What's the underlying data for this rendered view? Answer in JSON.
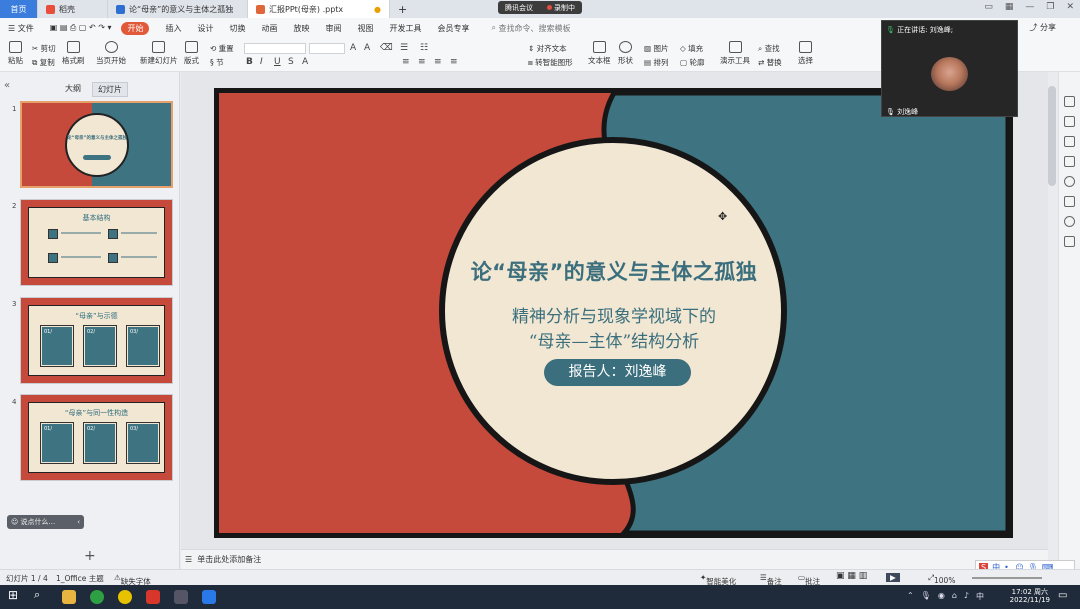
{
  "tabs": [
    {
      "label": "首页"
    },
    {
      "label": "稻壳"
    },
    {
      "label": "论“母亲”的意义与主体之孤独"
    },
    {
      "label": "汇报PPt(母亲) .pptx"
    }
  ],
  "meeting": {
    "app_label": "腾讯会议",
    "recording_label": "录制中"
  },
  "menu": {
    "file": "文件",
    "items": [
      "开始",
      "插入",
      "设计",
      "切换",
      "动画",
      "放映",
      "审阅",
      "视图",
      "开发工具",
      "会员专享"
    ],
    "active": "开始",
    "search_placeholder": "查找命令、搜索模板",
    "share": "分享"
  },
  "ribbon": {
    "paste": "粘贴",
    "cut": "剪切",
    "copy": "复制",
    "format_painter": "格式刷",
    "from_current": "当页开始",
    "new_slide": "新建幻灯片",
    "layout": "版式",
    "section": "节",
    "reset": "重置",
    "align_text": "对齐文本",
    "convert_smartart": "转智能图形",
    "textbox": "文本框",
    "shape": "形状",
    "picture": "图片",
    "fill": "填充",
    "arrange": "排列",
    "outline": "轮廓",
    "presentation_tools": "演示工具",
    "find": "查找",
    "replace": "替换",
    "select": "选择"
  },
  "leftpanel": {
    "tab_outline": "大纲",
    "tab_slides": "幻灯片",
    "slides": [
      {
        "num": "1",
        "title": "论“母亲”的意义与主体之孤独"
      },
      {
        "num": "2",
        "title": "基本结构"
      },
      {
        "num": "3",
        "title": "“母亲”与示德",
        "boxes": [
          "01/",
          "02/",
          "03/"
        ]
      },
      {
        "num": "4",
        "title": "“母亲”与同一性构造",
        "boxes": [
          "01/",
          "02/",
          "03/"
        ]
      }
    ],
    "talk_placeholder": "说点什么..."
  },
  "slide": {
    "title": "论“母亲”的意义与主体之孤独",
    "subtitle_line1": "精神分析与现象学视域下的",
    "subtitle_line2": "“母亲—主体”结构分析",
    "reporter": "报告人：刘逸峰"
  },
  "notes_placeholder": "单击此处添加备注",
  "video": {
    "speaking_label": "正在讲话: 刘逸峰;",
    "participant_name": "刘逸峰"
  },
  "status": {
    "slide_counter": "幻灯片 1 / 4",
    "theme": "1_Office 主题",
    "missing_font": "缺失字体",
    "smart_beautify": "智能美化",
    "notes": "备注",
    "comments": "批注",
    "zoom": "100%"
  },
  "taskbar": {
    "time": "17:02 周六",
    "date": "2022/11/19"
  },
  "colors": {
    "slide_red": "#c64a3b",
    "slide_teal": "#3e7381",
    "slide_cream": "#f2e7d2",
    "slide_text": "#3b6f7d",
    "active_menu": "#e05a3a"
  }
}
